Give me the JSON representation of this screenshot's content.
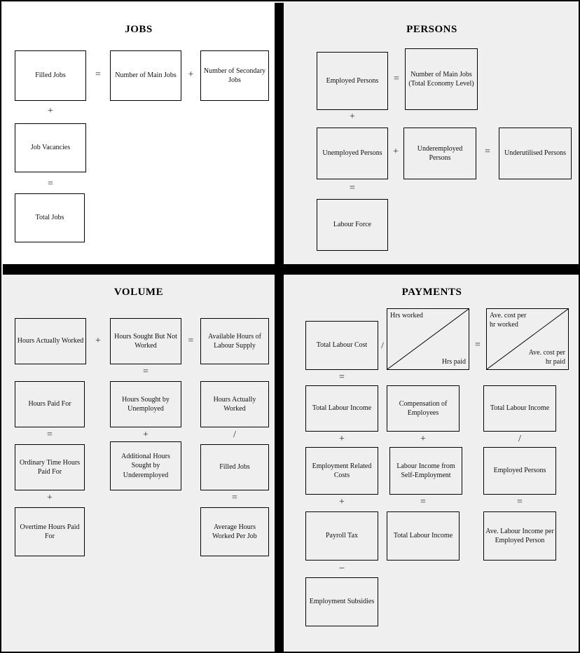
{
  "quadrants": {
    "jobs": {
      "title": "JOBS",
      "boxes": [
        {
          "label": "Filled Jobs"
        },
        {
          "label": "Number of Main Jobs"
        },
        {
          "label": "Number of Secondary Jobs"
        },
        {
          "label": "Job Vacancies"
        },
        {
          "label": "Total Jobs"
        }
      ],
      "operators": [
        "=",
        "+",
        "+",
        "="
      ]
    },
    "persons": {
      "title": "PERSONS",
      "boxes": [
        {
          "label": "Employed Persons"
        },
        {
          "label": "Number of Main Jobs\n(Total Economy Level)"
        },
        {
          "label": "Unemployed Persons"
        },
        {
          "label": "Underemployed Persons"
        },
        {
          "label": "Underutilised Persons"
        },
        {
          "label": "Labour Force"
        }
      ],
      "operators": [
        "=",
        "+",
        "+",
        "=",
        "="
      ]
    },
    "volume": {
      "title": "VOLUME",
      "boxes": [
        {
          "label": "Hours Actually Worked"
        },
        {
          "label": "Hours Sought But Not Worked"
        },
        {
          "label": "Available Hours of Labour Supply"
        },
        {
          "label": "Hours Paid For"
        },
        {
          "label": "Hours Sought by Unemployed"
        },
        {
          "label": "Hours Actually Worked"
        },
        {
          "label": "Ordinary Time Hours Paid For"
        },
        {
          "label": "Additional Hours Sought by Underemployed"
        },
        {
          "label": "Filled Jobs"
        },
        {
          "label": "Overtime Hours Paid For"
        },
        {
          "label": "Average Hours Worked Per Job"
        }
      ],
      "operators": [
        "+",
        "=",
        "=",
        "=",
        "+",
        "/",
        "+",
        "="
      ]
    },
    "payments": {
      "title": "PAYMENTS",
      "boxes": [
        {
          "label": "Total Labour Cost"
        },
        {
          "label": "Total Labour Income"
        },
        {
          "label": "Compensation of Employees"
        },
        {
          "label": "Total Labour Income"
        },
        {
          "label": "Employment Related Costs"
        },
        {
          "label": "Labour Income from Self-Employment"
        },
        {
          "label": "Employed Persons"
        },
        {
          "label": "Payroll Tax"
        },
        {
          "label": "Total Labour Income"
        },
        {
          "label": "Ave. Labour Income per Employed Person"
        },
        {
          "label": "Employment Subsidies"
        }
      ],
      "split_boxes": [
        {
          "top_left": "Hrs worked",
          "bottom_right": "Hrs paid"
        },
        {
          "top_left": "Ave. cost per\nhr worked",
          "bottom_right": "Ave. cost per\nhr paid"
        }
      ],
      "operators": [
        "/",
        "=",
        "=",
        "+",
        "+",
        "/",
        "+",
        "=",
        "=",
        "–"
      ]
    }
  },
  "colors": {
    "frame": "#000000",
    "jobs_background": "#ffffff",
    "panel_background": "#efefef",
    "box_border": "#000000",
    "text": "#111111"
  }
}
